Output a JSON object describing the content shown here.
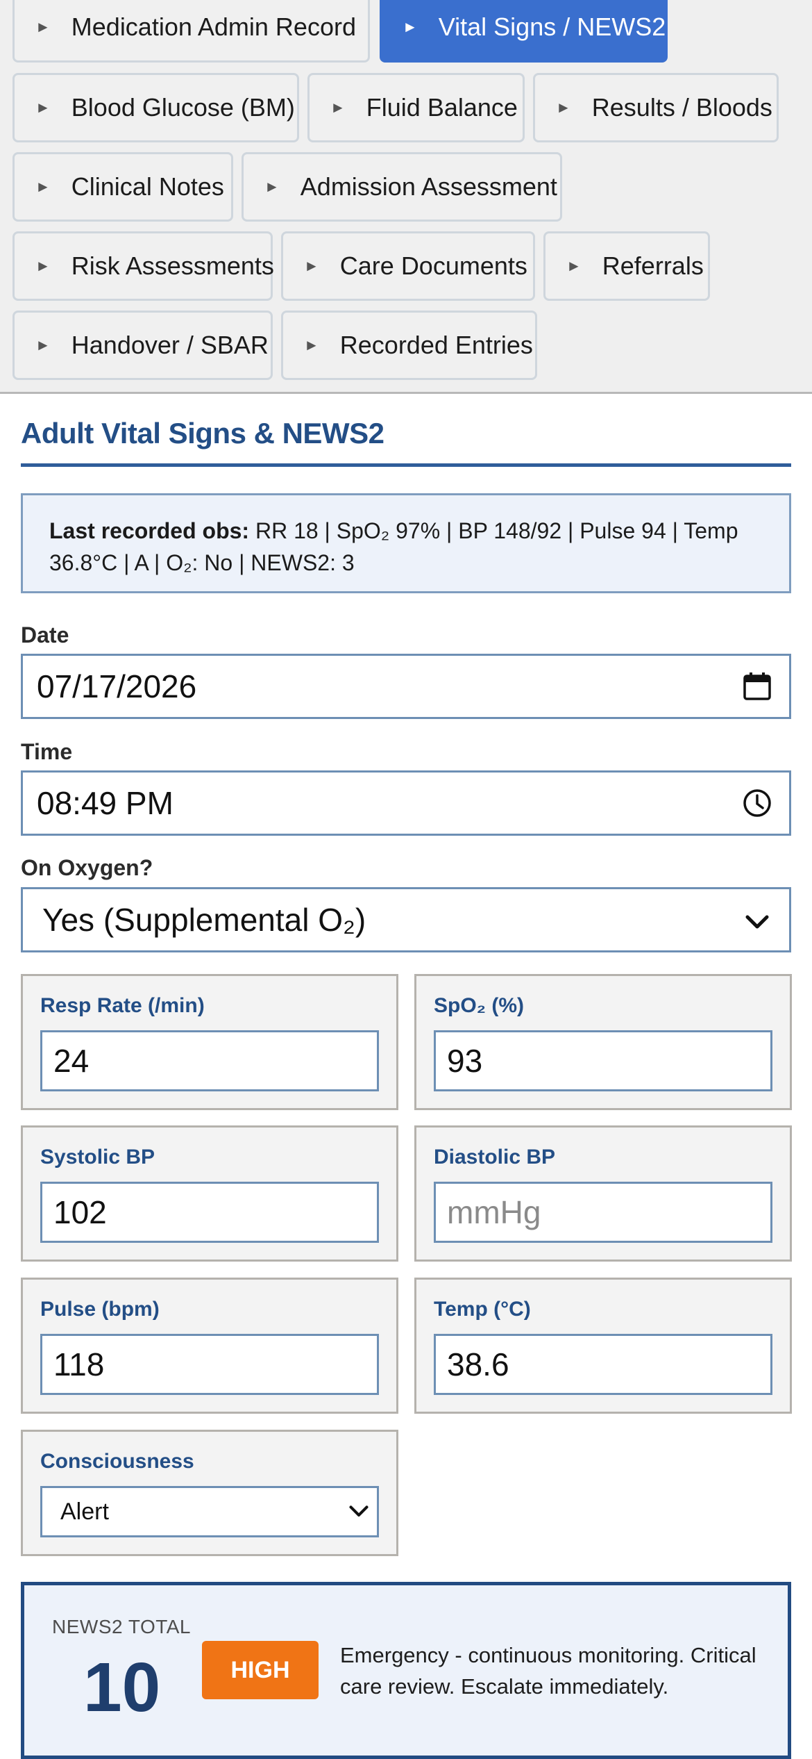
{
  "tabs": [
    {
      "label": "Medication Admin Record",
      "active": false
    },
    {
      "label": "Vital Signs / NEWS2",
      "active": true
    },
    {
      "label": "Blood Glucose (BM)",
      "active": false
    },
    {
      "label": "Fluid Balance",
      "active": false
    },
    {
      "label": "Results / Bloods",
      "active": false
    },
    {
      "label": "Clinical Notes",
      "active": false
    },
    {
      "label": "Admission Assessment",
      "active": false
    },
    {
      "label": "Risk Assessments",
      "active": false
    },
    {
      "label": "Care Documents",
      "active": false
    },
    {
      "label": "Referrals",
      "active": false
    },
    {
      "label": "Handover / SBAR",
      "active": false
    },
    {
      "label": "Recorded Entries",
      "active": false
    }
  ],
  "tab_arrow": "►",
  "section": {
    "title": "Adult Vital Signs & NEWS2"
  },
  "last_obs": {
    "label": "Last recorded obs:",
    "text": "RR 18 | SpO₂ 97% | BP 148/92 | Pulse 94 | Temp 36.8°C | A | O₂: No | NEWS2: 3"
  },
  "form": {
    "date_label": "Date",
    "date_value": "07/17/2026",
    "time_label": "Time",
    "time_value": "08:49 PM",
    "oxygen_label": "On Oxygen?",
    "oxygen_value": "Yes (Supplemental O₂)",
    "resp_label": "Resp Rate (/min)",
    "resp_value": "24",
    "spo2_label": "SpO₂ (%)",
    "spo2_value": "93",
    "sbp_label": "Systolic BP",
    "sbp_value": "102",
    "dbp_label": "Diastolic BP",
    "dbp_placeholder": "mmHg",
    "pulse_label": "Pulse (bpm)",
    "pulse_value": "118",
    "temp_label": "Temp (°C)",
    "temp_value": "38.6",
    "consciousness_label": "Consciousness",
    "consciousness_value": "Alert"
  },
  "news2": {
    "label": "NEWS2 TOTAL",
    "score": "10",
    "risk": "HIGH",
    "action": "Emergency - continuous monitoring. Critical care review. Escalate immediately."
  },
  "icons": {
    "calendar": "calendar-icon",
    "clock": "clock-icon",
    "chevron": "chevron-down-icon",
    "tab_arrow": "play-arrow-icon"
  },
  "colors": {
    "active_tab": "#3a6fce",
    "heading": "#234e86",
    "risk_high": "#f07415",
    "field_border": "#6d8fb4"
  }
}
